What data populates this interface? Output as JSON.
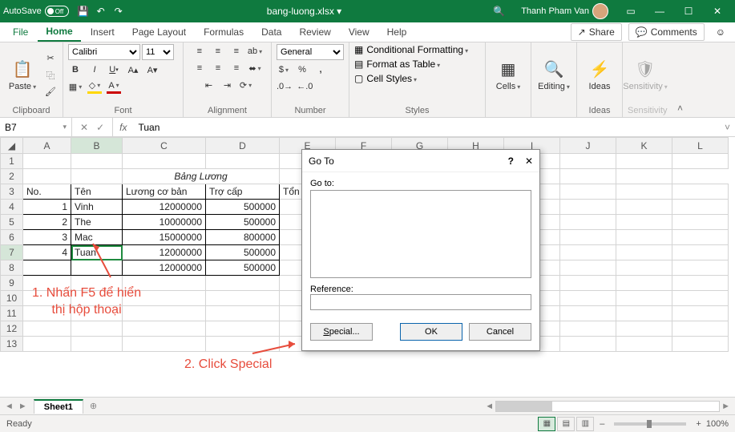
{
  "titlebar": {
    "autosave_label": "AutoSave",
    "autosave_state": "Off",
    "filename": "bang-luong.xlsx  ▾",
    "username": "Thanh Pham Van"
  },
  "tabs": {
    "file": "File",
    "home": "Home",
    "insert": "Insert",
    "pagelayout": "Page Layout",
    "formulas": "Formulas",
    "data": "Data",
    "review": "Review",
    "view": "View",
    "help": "Help",
    "share": "Share",
    "comments": "Comments"
  },
  "ribbon": {
    "clipboard": {
      "paste": "Paste",
      "label": "Clipboard"
    },
    "font": {
      "name": "Calibri",
      "size": "11",
      "label": "Font"
    },
    "alignment": {
      "label": "Alignment"
    },
    "number": {
      "format": "General",
      "label": "Number"
    },
    "styles": {
      "cond": "Conditional Formatting",
      "table": "Format as Table",
      "cell": "Cell Styles",
      "label": "Styles"
    },
    "cells": {
      "btn": "Cells",
      "label": ""
    },
    "editing": {
      "btn": "Editing",
      "label": ""
    },
    "ideas": {
      "btn": "Ideas",
      "label": "Ideas"
    },
    "sensitivity": {
      "btn": "Sensitivity",
      "label": "Sensitivity"
    }
  },
  "formula": {
    "cellref": "B7",
    "value": "Tuan"
  },
  "columns": [
    "A",
    "B",
    "C",
    "D",
    "E",
    "F",
    "G",
    "H",
    "I",
    "J",
    "K",
    "L"
  ],
  "sheet": {
    "title": "Bảng Lương",
    "headers": {
      "a": "No.",
      "b": "Tên",
      "c": "Lương cơ bản",
      "d": "Trợ cấp",
      "e": "Tổn"
    },
    "rows": [
      {
        "a": "1",
        "b": "Vinh",
        "c": "12000000",
        "d": "500000"
      },
      {
        "a": "2",
        "b": "The",
        "c": "10000000",
        "d": "500000"
      },
      {
        "a": "3",
        "b": "Mac",
        "c": "15000000",
        "d": "800000"
      },
      {
        "a": "4",
        "b": "Tuan",
        "c": "12000000",
        "d": "500000"
      },
      {
        "a": "",
        "b": "",
        "c": "12000000",
        "d": "500000"
      }
    ]
  },
  "dialog": {
    "title": "Go To",
    "goto_label": "Go to:",
    "ref_label": "Reference:",
    "ref_value": "",
    "special": "Special...",
    "ok": "OK",
    "cancel": "Cancel"
  },
  "annotations": {
    "a1_l1": "1. Nhấn F5 để hiển",
    "a1_l2": "thị hộp thoại",
    "a2": "2. Click Special"
  },
  "sheettabs": {
    "name": "Sheet1"
  },
  "status": {
    "ready": "Ready",
    "zoom": "100%"
  }
}
